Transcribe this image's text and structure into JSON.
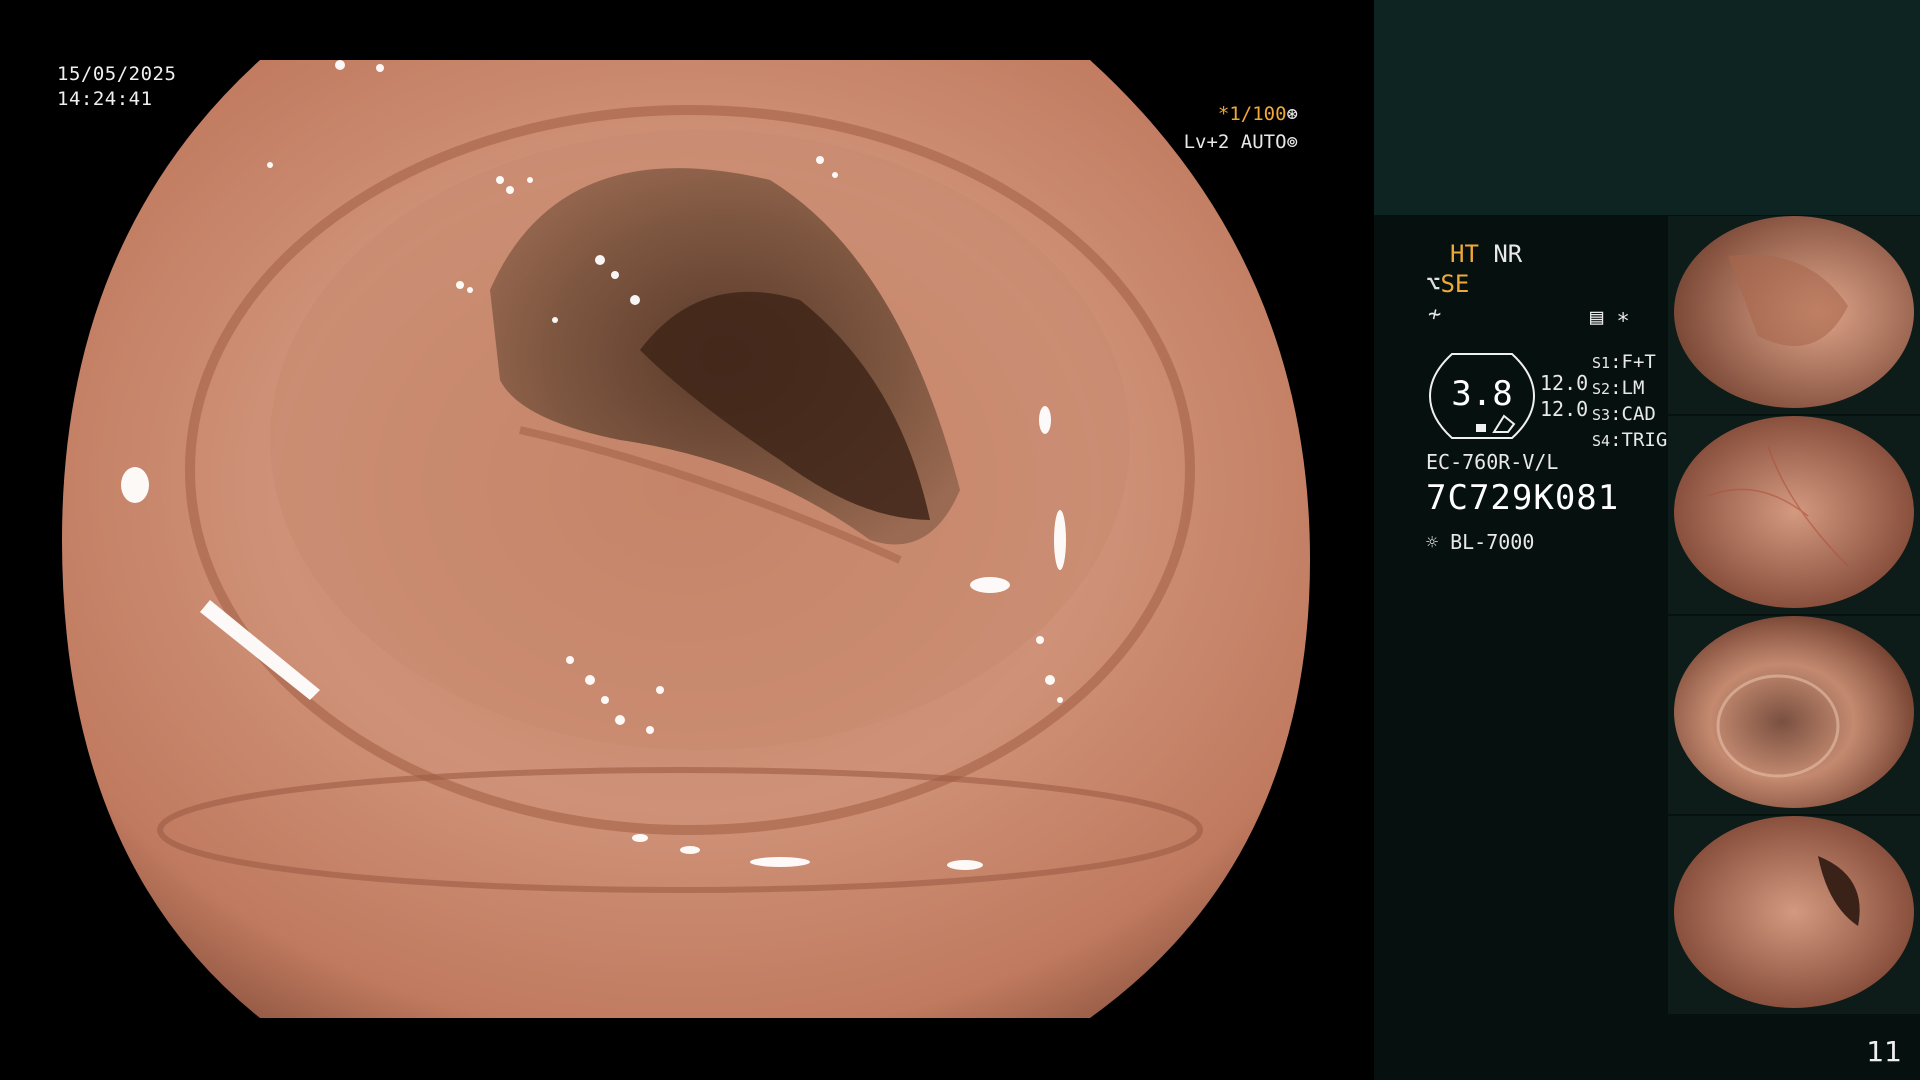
{
  "overlay": {
    "date": "15/05/2025",
    "time": "14:24:41",
    "shutter": "*1/100",
    "shutter_icon": "aperture-icon",
    "level": "Lv+2 AUTO",
    "level_icon": "iris-icon"
  },
  "panel": {
    "ht_label": "HT",
    "nr_label": "NR",
    "se_label": "SE",
    "gauge_value": "3.8",
    "values": [
      "12.0",
      "12.0"
    ],
    "switches": [
      {
        "key": "S1",
        "value": "F+T"
      },
      {
        "key": "S2",
        "value": "LM"
      },
      {
        "key": "S3",
        "value": "CAD"
      },
      {
        "key": "S4",
        "value": "TRIG"
      }
    ],
    "scope_model": "EC-760R-V/L",
    "serial": "7C729K081",
    "light_source": "BL-7000",
    "page_number": "11"
  },
  "colors": {
    "accent_orange": "#f0a838",
    "panel_top": "#0d2422",
    "panel_bg": "#06100f",
    "tissue": "#c98a6e"
  }
}
